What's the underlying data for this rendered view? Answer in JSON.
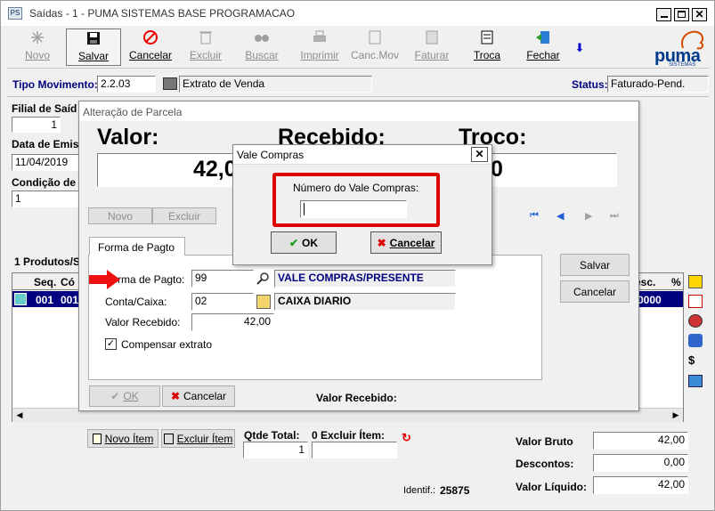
{
  "window": {
    "title": "Saídas - 1 - PUMA SISTEMAS  BASE PROGRAMACAO"
  },
  "toolbar": {
    "novo": "Novo",
    "salvar": "Salvar",
    "cancelar": "Cancelar",
    "excluir": "Excluir",
    "buscar": "Buscar",
    "imprimir": "Imprimir",
    "canc_mov": "Canc.Mov",
    "faturar": "Faturar",
    "troca": "Troca",
    "fechar": "Fechar"
  },
  "brand": {
    "name": "puma",
    "sub": "SISTEMAS"
  },
  "header": {
    "tipo_label": "Tipo Movimento:",
    "tipo_code": "2.2.03",
    "tipo_desc": "Extrato de Venda",
    "status_label": "Status:",
    "status_value": "Faturado-Pend."
  },
  "left": {
    "filial_label": "Filial de Saíd",
    "filial_value": "1",
    "data_label": "Data de Emis",
    "data_value": "11/04/2019",
    "cond_label": "Condição de",
    "cond_value": "1",
    "produtos_tab": "1 Produtos/S"
  },
  "grid": {
    "headers": [
      "Seq.",
      "Có"
    ],
    "row": [
      "001",
      "001"
    ],
    "right_header": "esc.",
    "pct_header": "%",
    "right_value": "0000"
  },
  "parcela": {
    "title": "Alteração de Parcela",
    "valor_label": "Valor:",
    "valor_value": "42,0",
    "recebido_label": "Recebido:",
    "troco_label": "Troco:",
    "troco_value": "0",
    "novo": "Novo",
    "excluir": "Excluir",
    "tab": "Forma de Pagto",
    "forma_label": "Forma de Pagto:",
    "forma_code": "99",
    "forma_desc": "VALE COMPRAS/PRESENTE",
    "conta_label": "Conta/Caixa:",
    "conta_code": "02",
    "conta_desc": "CAIXA DIARIO",
    "valor_rec_label": "Valor Recebido:",
    "valor_rec_value": "42,00",
    "compensar": "Compensar extrato",
    "salvar": "Salvar",
    "cancelar": "Cancelar",
    "ok": "OK",
    "cancelar2": "Cancelar",
    "valor_recebido_footer": "Valor Recebido:"
  },
  "vale": {
    "title": "Vale Compras",
    "label": "Número do Vale Compras:",
    "input_value": "",
    "ok": "OK",
    "cancelar": "Cancelar"
  },
  "footer": {
    "novo_item": "Novo Ítem",
    "excluir_item": "Excluir Ítem",
    "qtde_label": "Qtde Total:",
    "qtde_value": "1",
    "excluir_label": "0 Excluir Ítem:",
    "identif_label": "Identif.:",
    "identif_value": "25875",
    "bruto_label": "Valor Bruto",
    "bruto_value": "42,00",
    "desc_label": "Descontos:",
    "desc_value": "0,00",
    "liquido_label": "Valor Líquido:",
    "liquido_value": "42,00"
  },
  "colors": {
    "accent_blue": "#000080",
    "highlight_red": "#e00000",
    "grid_selection": "#000080"
  }
}
